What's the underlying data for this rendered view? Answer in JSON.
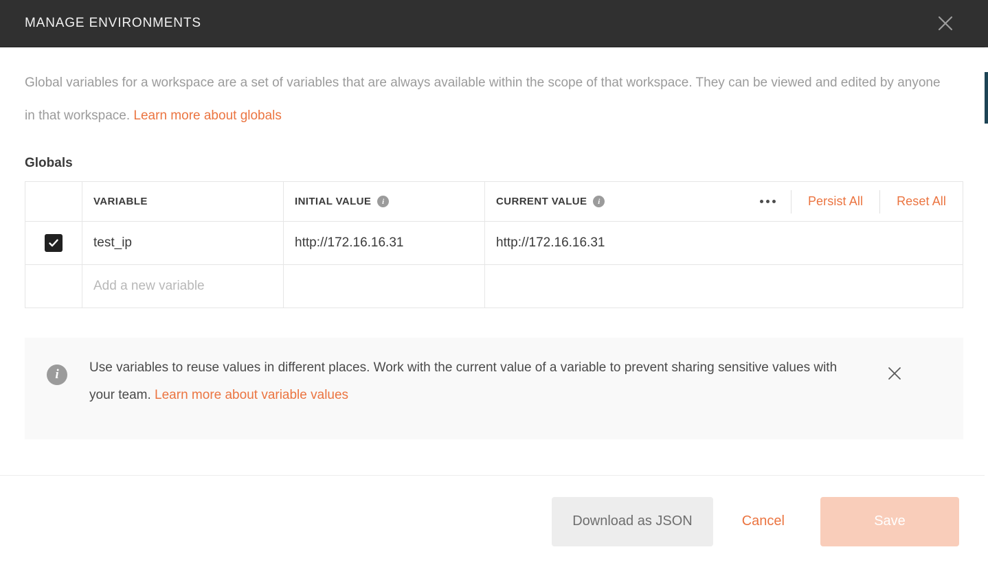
{
  "header": {
    "title": "MANAGE ENVIRONMENTS",
    "close_icon": "close-icon"
  },
  "description": {
    "text_before_link": "Global variables for a workspace are a set of variables that are always available within the scope of that workspace. They can be viewed and edited by anyone in that workspace. ",
    "link_label": "Learn more about globals"
  },
  "section": {
    "title": "Globals"
  },
  "table": {
    "columns": [
      {
        "key": "check",
        "label": ""
      },
      {
        "key": "variable",
        "label": "VARIABLE"
      },
      {
        "key": "initial_value",
        "label": "INITIAL VALUE",
        "info": true
      },
      {
        "key": "current_value",
        "label": "CURRENT VALUE",
        "info": true
      }
    ],
    "header_actions": {
      "more_label": "•••",
      "persist_all_label": "Persist All",
      "reset_all_label": "Reset All"
    },
    "rows": [
      {
        "checked": true,
        "variable": "test_ip",
        "initial_value": "http://172.16.16.31",
        "current_value": "http://172.16.16.31"
      }
    ],
    "new_row_placeholder": "Add a new variable"
  },
  "callout": {
    "icon": "info-icon",
    "text_before_link": "Use variables to reuse values in different places. Work with the current value of a variable to prevent sharing sensitive values with your team. ",
    "link_label": "Learn more about variable values",
    "close_icon": "close-icon"
  },
  "footer": {
    "download_label": "Download as JSON",
    "cancel_label": "Cancel",
    "save_label": "Save"
  },
  "colors": {
    "accent_orange": "#eb7440",
    "header_dark": "#303030",
    "save_disabled": "#f9cdba",
    "scrollbar_thumb": "#1d4455"
  }
}
